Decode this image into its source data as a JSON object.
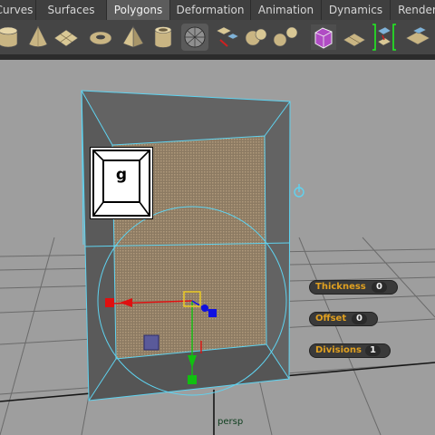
{
  "tabs": [
    {
      "label": "Curves",
      "active": false
    },
    {
      "label": "Surfaces",
      "active": false
    },
    {
      "label": "Polygons",
      "active": true
    },
    {
      "label": "Deformation",
      "active": false
    },
    {
      "label": "Animation",
      "active": false
    },
    {
      "label": "Dynamics",
      "active": false
    },
    {
      "label": "Render",
      "active": false
    }
  ],
  "shelf_icons": [
    "poly-cylinder-icon",
    "poly-cone-icon",
    "poly-plane-icon",
    "poly-torus-icon",
    "poly-pyramid-icon",
    "poly-pipe-icon",
    "poly-soccer-ball-icon",
    "extract-icon",
    "combine-icon",
    "separate-icon",
    "smooth-icon",
    "texture-editor-icon",
    "bridge-tool-icon",
    "extrude-icon"
  ],
  "viewport": {
    "hotkey": "g",
    "camera_label": "persp",
    "hud": [
      {
        "label": "Thickness",
        "value": "0"
      },
      {
        "label": "Offset",
        "value": "0"
      },
      {
        "label": "Divisions",
        "value": "1"
      }
    ]
  },
  "colors": {
    "selection": "#5fd3f0",
    "hud_label": "#e0a020",
    "axis_x": "#e01010",
    "axis_y": "#10c010",
    "axis_z": "#1010e0"
  }
}
